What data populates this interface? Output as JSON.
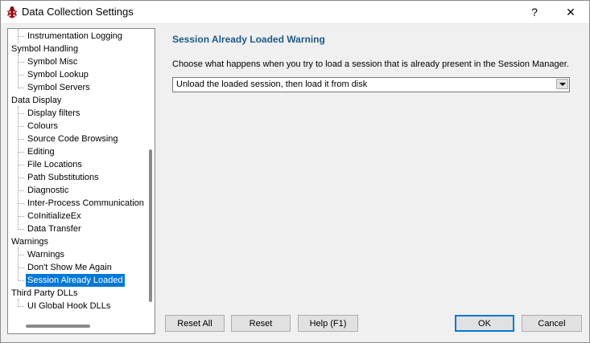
{
  "window": {
    "title": "Data Collection Settings",
    "help_symbol": "?",
    "close_symbol": "✕",
    "app_icon": "bug-icon"
  },
  "tree": {
    "items": [
      {
        "label": "Instrumentation Logging",
        "level": 1
      },
      {
        "label": "Symbol Handling",
        "level": 0
      },
      {
        "label": "Symbol Misc",
        "level": 1
      },
      {
        "label": "Symbol Lookup",
        "level": 1
      },
      {
        "label": "Symbol Servers",
        "level": 1
      },
      {
        "label": "Data Display",
        "level": 0
      },
      {
        "label": "Display filters",
        "level": 1
      },
      {
        "label": "Colours",
        "level": 1
      },
      {
        "label": "Source Code Browsing",
        "level": 1
      },
      {
        "label": "Editing",
        "level": 1
      },
      {
        "label": "File Locations",
        "level": 1
      },
      {
        "label": "Path Substitutions",
        "level": 1
      },
      {
        "label": "Diagnostic",
        "level": 1
      },
      {
        "label": "Inter-Process Communication",
        "level": 1
      },
      {
        "label": "CoInitializeEx",
        "level": 1
      },
      {
        "label": "Data Transfer",
        "level": 1
      },
      {
        "label": "Warnings",
        "level": 0
      },
      {
        "label": "Warnings",
        "level": 1
      },
      {
        "label": "Don't Show Me Again",
        "level": 1
      },
      {
        "label": "Session Already Loaded",
        "level": 1,
        "selected": true
      },
      {
        "label": "Third Party DLLs",
        "level": 0
      },
      {
        "label": "UI Global Hook DLLs",
        "level": 1
      }
    ]
  },
  "content": {
    "section_title": "Session Already Loaded Warning",
    "description": "Choose what happens when you try to load a session that is already present in the Session Manager.",
    "dropdown_value": "Unload the loaded session, then load it from disk"
  },
  "buttons": {
    "reset_all": "Reset All",
    "reset": "Reset",
    "help": "Help (F1)",
    "ok": "OK",
    "cancel": "Cancel"
  },
  "colors": {
    "accent": "#0078d7",
    "section_title": "#1c5a8a"
  }
}
